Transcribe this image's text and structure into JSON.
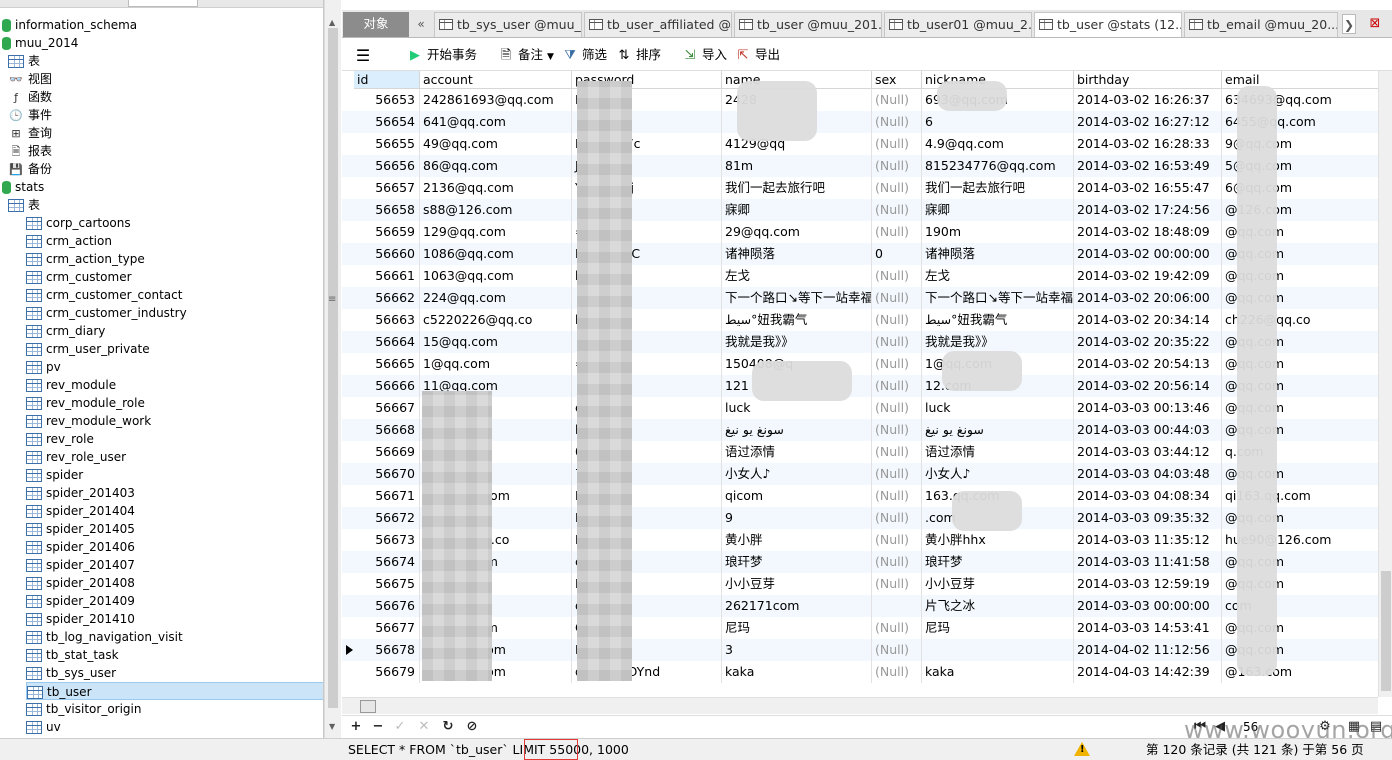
{
  "tree": {
    "nodes": [
      {
        "label": "information_schema",
        "kind": "db",
        "indent": 0
      },
      {
        "label": "muu_2014",
        "kind": "db",
        "indent": 0
      },
      {
        "label": "表",
        "kind": "table",
        "indent": 1
      },
      {
        "label": "视图",
        "kind": "view",
        "indent": 1
      },
      {
        "label": "函数",
        "kind": "func",
        "indent": 1
      },
      {
        "label": "事件",
        "kind": "event",
        "indent": 1
      },
      {
        "label": "查询",
        "kind": "query",
        "indent": 1
      },
      {
        "label": "报表",
        "kind": "report",
        "indent": 1
      },
      {
        "label": "备份",
        "kind": "backup",
        "indent": 1
      },
      {
        "label": "stats",
        "kind": "db",
        "indent": 0
      },
      {
        "label": "表",
        "kind": "table",
        "indent": 1
      },
      {
        "label": "corp_cartoons",
        "kind": "table",
        "indent": 2
      },
      {
        "label": "crm_action",
        "kind": "table",
        "indent": 2
      },
      {
        "label": "crm_action_type",
        "kind": "table",
        "indent": 2
      },
      {
        "label": "crm_customer",
        "kind": "table",
        "indent": 2
      },
      {
        "label": "crm_customer_contact",
        "kind": "table",
        "indent": 2
      },
      {
        "label": "crm_customer_industry",
        "kind": "table",
        "indent": 2
      },
      {
        "label": "crm_diary",
        "kind": "table",
        "indent": 2
      },
      {
        "label": "crm_user_private",
        "kind": "table",
        "indent": 2
      },
      {
        "label": "pv",
        "kind": "table",
        "indent": 2
      },
      {
        "label": "rev_module",
        "kind": "table",
        "indent": 2
      },
      {
        "label": "rev_module_role",
        "kind": "table",
        "indent": 2
      },
      {
        "label": "rev_module_work",
        "kind": "table",
        "indent": 2
      },
      {
        "label": "rev_role",
        "kind": "table",
        "indent": 2
      },
      {
        "label": "rev_role_user",
        "kind": "table",
        "indent": 2
      },
      {
        "label": "spider",
        "kind": "table",
        "indent": 2
      },
      {
        "label": "spider_201403",
        "kind": "table",
        "indent": 2
      },
      {
        "label": "spider_201404",
        "kind": "table",
        "indent": 2
      },
      {
        "label": "spider_201405",
        "kind": "table",
        "indent": 2
      },
      {
        "label": "spider_201406",
        "kind": "table",
        "indent": 2
      },
      {
        "label": "spider_201407",
        "kind": "table",
        "indent": 2
      },
      {
        "label": "spider_201408",
        "kind": "table",
        "indent": 2
      },
      {
        "label": "spider_201409",
        "kind": "table",
        "indent": 2
      },
      {
        "label": "spider_201410",
        "kind": "table",
        "indent": 2
      },
      {
        "label": "tb_log_navigation_visit",
        "kind": "table",
        "indent": 2
      },
      {
        "label": "tb_stat_task",
        "kind": "table",
        "indent": 2
      },
      {
        "label": "tb_sys_user",
        "kind": "table",
        "indent": 2
      },
      {
        "label": "tb_user",
        "kind": "table",
        "indent": 2,
        "selected": true
      },
      {
        "label": "tb_visitor_origin",
        "kind": "table",
        "indent": 2
      },
      {
        "label": "uv",
        "kind": "table",
        "indent": 2
      }
    ]
  },
  "tabs": {
    "objects_label": "对象",
    "items": [
      {
        "label": "tb_sys_user @muu_...",
        "active": false
      },
      {
        "label": "tb_user_affiliated @...",
        "active": false
      },
      {
        "label": "tb_user @muu_201...",
        "active": false
      },
      {
        "label": "tb_user01 @muu_2...",
        "active": false
      },
      {
        "label": "tb_user @stats (12...",
        "active": true
      },
      {
        "label": "tb_email @muu_20...",
        "active": false
      }
    ]
  },
  "toolbar": {
    "begin_transaction": "开始事务",
    "memo": "备注",
    "filter": "筛选",
    "sort": "排序",
    "import": "导入",
    "export": "导出"
  },
  "grid": {
    "columns": [
      "id",
      "account",
      "password",
      "name",
      "sex",
      "nickname",
      "birthday",
      "email"
    ],
    "rows": [
      [
        "56653",
        "242861693@qq.com",
        "NHpnM=",
        "2428",
        "(Null)",
        "693@qq.com",
        "2014-03-02 16:26:37",
        "634693@qq.com"
      ],
      [
        "56654",
        "641@qq.com",
        "",
        "",
        "(Null)",
        "6",
        "2014-03-02 16:27:12",
        "6455@qq.com"
      ],
      [
        "56655",
        "49@qq.com",
        "IphVraO7c",
        "4129@qq",
        "(Null)",
        "4.9@qq.com",
        "2014-03-02 16:28:33",
        "9@qq.com"
      ],
      [
        "56656",
        "86@qq.com",
        "J=",
        "81m",
        "(Null)",
        "815234776@qq.com",
        "2014-03-02 16:53:49",
        "5@qq.com"
      ],
      [
        "56657",
        "2136@qq.com",
        "YpU6expj",
        "我们一起去旅行吧",
        "(Null)",
        "我们一起去旅行吧",
        "2014-03-02 16:55:47",
        "6@qq.com"
      ],
      [
        "56658",
        "s88@126.com",
        "",
        "寐卿",
        "(Null)",
        "寐卿",
        "2014-03-02 17:24:56",
        "@126.com"
      ],
      [
        "56659",
        "129@qq.com",
        "=",
        "29@qq.com",
        "(Null)",
        "190m",
        "2014-03-02 18:48:09",
        "@qq.com"
      ],
      [
        "56660",
        "1086@qq.com",
        "P2VvjIQgC",
        "诸神陨落",
        "0",
        "诸神陨落",
        "2014-03-02 00:00:00",
        "@qq.com"
      ],
      [
        "56661",
        "1063@qq.com",
        "kLQ",
        "左戈",
        "(Null)",
        "左戈",
        "2014-03-02 19:42:09",
        "@qq.com"
      ],
      [
        "56662",
        "224@qq.com",
        "",
        "下一个路口↘等下一站幸福",
        "(Null)",
        "下一个路口↘等下一站幸福",
        "2014-03-02 20:06:00",
        "@qq.com"
      ],
      [
        "56663",
        "c5220226@qq.co",
        "k",
        "سيط°妞我霸气",
        "(Null)",
        "سيط°妞我霸气",
        "2014-03-02 20:34:14",
        "ch226@qq.co"
      ],
      [
        "56664",
        "15@qq.com",
        "",
        "我就是我》》",
        "(Null)",
        "我就是我》》",
        "2014-03-02 20:35:22",
        "@qq.com"
      ],
      [
        "56665",
        "1@qq.com",
        "=",
        "150408@q",
        "(Null)",
        "1@qq.com",
        "2014-03-02 20:54:13",
        "@qq.com"
      ],
      [
        "56666",
        "11@qq.com",
        "",
        "121",
        "(Null)",
        "12.com",
        "2014-03-02 20:56:14",
        "@qq.com"
      ],
      [
        "56667",
        "8@qq.com",
        "eKdlc",
        "luck",
        "(Null)",
        "luck",
        "2014-03-03 00:13:46",
        "@qq.com"
      ],
      [
        "56668",
        "@qq.com",
        "kgur",
        "سونغ يو نيغ",
        "(Null)",
        "سونغ يو نيغ",
        "2014-03-03 00:44:03",
        "@qq.com"
      ],
      [
        "56669",
        "qq.com",
        "066",
        "语过添情",
        "(Null)",
        "语过添情",
        "2014-03-03 03:44:12",
        "q.com"
      ],
      [
        "56670",
        "1@qq.com",
        "729",
        "小女人♪",
        "(Null)",
        "小女人♪",
        "2014-03-03 04:03:48",
        "@qq.com"
      ],
      [
        "56671",
        "@163.qq.com",
        "Dw",
        "qicom",
        "(Null)",
        "163.qq.com",
        "2014-03-03 04:08:34",
        "qi163.qq.com"
      ],
      [
        "56672",
        "5@qq.com",
        "BIA",
        "9",
        "(Null)",
        ".com",
        "2014-03-03 09:35:32",
        "@qq.com"
      ],
      [
        "56673",
        "ge90@126.co",
        "RH",
        "黄小胖",
        "(Null)",
        "黄小胖hhx",
        "2014-03-03 11:35:12",
        "hue90@126.com"
      ],
      [
        "56674",
        "36@qq.com",
        "eQze48C",
        "琅玕梦",
        "(Null)",
        "琅玕梦",
        "2014-03-03 11:41:58",
        "@qq.com"
      ],
      [
        "56675",
        "5@qq.com",
        "Npz2hw",
        "小小豆芽",
        "(Null)",
        "小小豆芽",
        "2014-03-03 12:59:19",
        "@qq.com"
      ],
      [
        "56676",
        "2@qq.com",
        "qM",
        "262171com",
        "",
        "片飞之冰",
        "2014-03-03 00:00:00",
        "com"
      ],
      [
        "56677",
        "10@qq.com",
        "C6p7",
        "尼玛",
        "(Null)",
        "尼玛",
        "2014-03-03 14:53:41",
        "@qq.com"
      ],
      [
        "56678",
        "198@qq.com",
        "E",
        "3",
        "(Null)",
        "",
        "2014-04-02 11:12:56",
        "@qq.com"
      ],
      [
        "56679",
        "43@163.com",
        "qYD0uj5OYnd",
        "kaka",
        "(Null)",
        "kaka",
        "2014-04-03 14:42:39",
        "@163.com"
      ]
    ],
    "current_row_index": 25
  },
  "navbar": {
    "page": "56"
  },
  "status": {
    "sql": "SELECT * FROM `tb_user` LIMIT 55000, 1000",
    "record_info": "第 120 条记录 (共 121 条) 于第 56 页"
  },
  "watermark": "www.wooyun.org",
  "colors": {
    "selected_tree": "#cce4f7",
    "alt_row": "#f2f8fd",
    "null_text": "#9a9a9a",
    "sql_highlight": "#e53935"
  }
}
